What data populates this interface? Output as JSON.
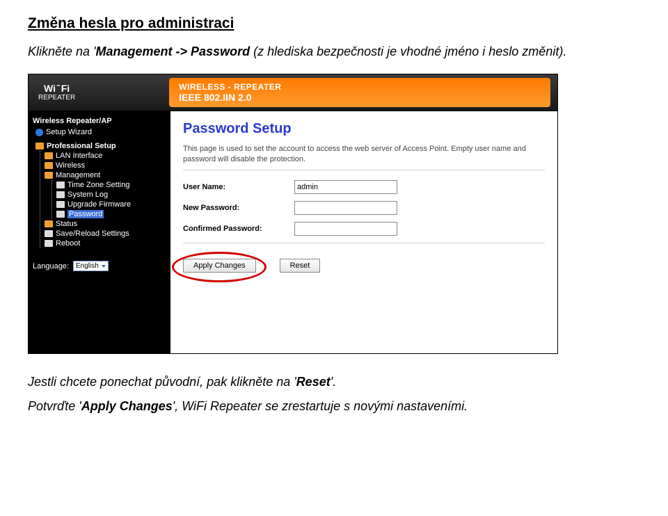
{
  "doc": {
    "title": "Změna hesla pro administraci",
    "p1_pre": "Klikněte na '",
    "p1_bold": "Management -> Password",
    "p1_post": " (z hlediska bezpečnosti je vhodné jméno i heslo změnit).",
    "p2_pre": "Jestli chcete ponechat původní, pak klikněte na '",
    "p2_bold": "Reset",
    "p2_post": "'.",
    "p3_pre": "Potvrďte '",
    "p3_bold": "Apply Changes",
    "p3_post": "', WiFi Repeater se zrestartuje s novými nastaveními."
  },
  "app": {
    "logo_top": "Wi ̑ Fi",
    "logo_bot": "REPEATER",
    "banner_t1": "WIRELESS - REPEATER",
    "banner_t2": "IEEE 802.IIN 2.0"
  },
  "sidebar": {
    "root": "Wireless Repeater/AP",
    "wizard": "Setup Wizard",
    "prof": "Professional Setup",
    "items": [
      "LAN Interface",
      "Wireless",
      "Management"
    ],
    "mgmt_sub": [
      "Time Zone Setting",
      "System Log",
      "Upgrade Firmware",
      "Password"
    ],
    "after": [
      "Status",
      "Save/Reload Settings",
      "Reboot"
    ],
    "lang_label": "Language:",
    "lang_value": "English"
  },
  "main": {
    "title": "Password Setup",
    "desc": "This page is used to set the account to access the web server of Access Point. Empty user name and password will disable the protection.",
    "user_label": "User Name:",
    "user_value": "admin",
    "newpw_label": "New Password:",
    "confpw_label": "Confirmed Password:",
    "btn_apply": "Apply Changes",
    "btn_reset": "Reset"
  }
}
